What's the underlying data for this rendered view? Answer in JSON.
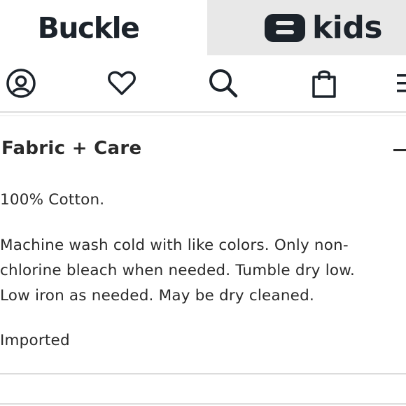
{
  "brand": {
    "buckle_logo": "Buckle",
    "kids_logo": "kids"
  },
  "nav": {
    "account": "account-icon",
    "wishlist": "heart-icon",
    "search": "search-icon",
    "bag": "shopping-bag-icon",
    "menu": "menu-icon"
  },
  "section": {
    "title": "Fabric + Care",
    "toggle": "−",
    "material": "100% Cotton.",
    "care_lines": [
      "Machine wash cold with like colors. Only non-",
      "chlorine bleach when needed. Tumble dry low.",
      "Low iron as needed. May be dry cleaned."
    ],
    "origin": "Imported"
  },
  "colors": {
    "logo": "#1c232b",
    "kids_tab_bg": "#e8e8e8",
    "text": "#2a2a2a",
    "divider": "#dcdcdc"
  }
}
